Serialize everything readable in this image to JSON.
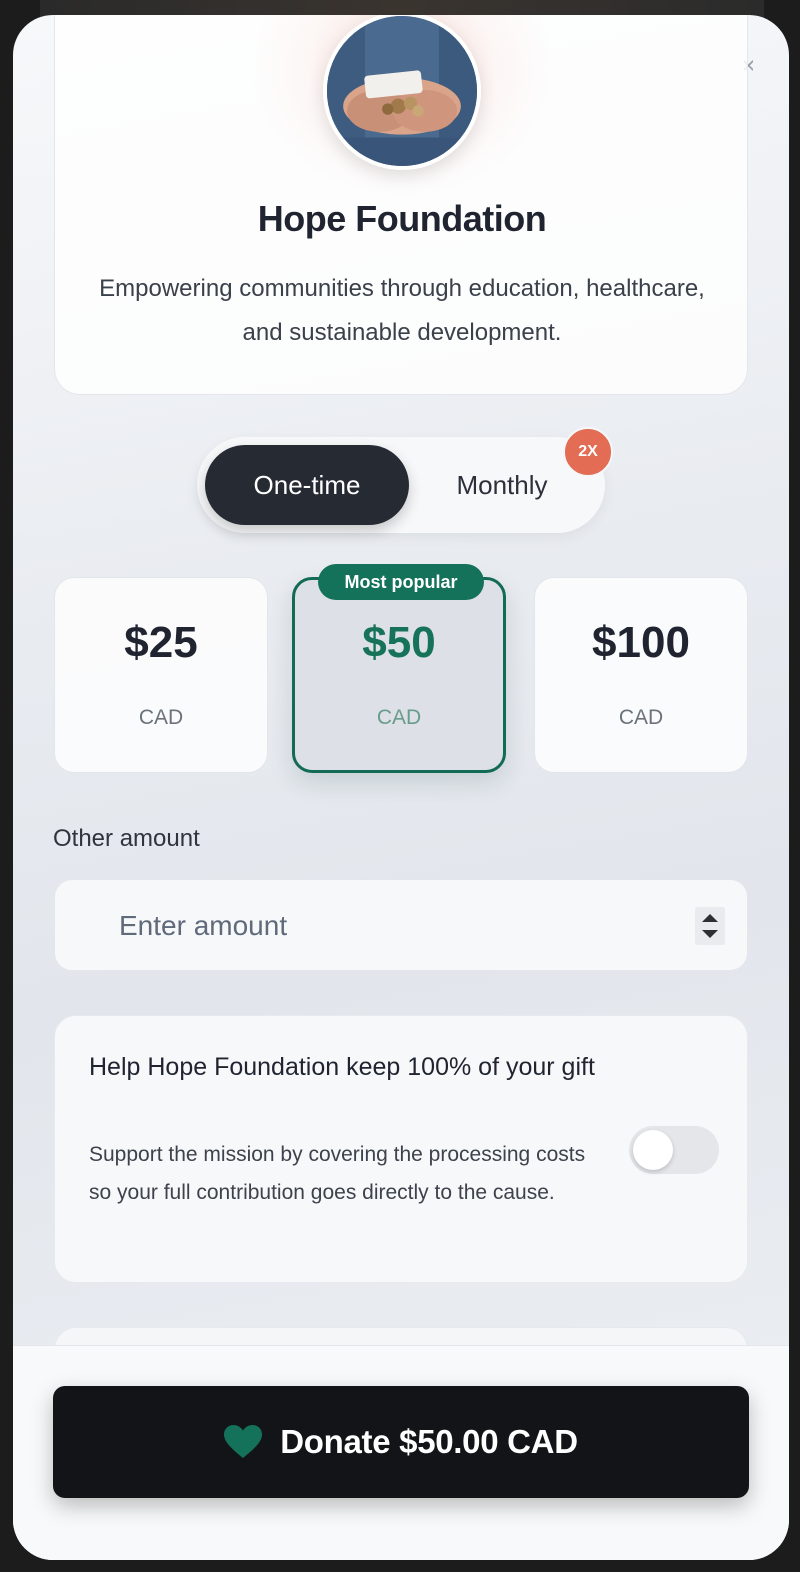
{
  "organization": {
    "name": "Hope Foundation",
    "description": "Empowering communities through education, healthcare, and sustainable development.",
    "avatar_icon": "hands-holding-coins-image"
  },
  "frequency": {
    "options": [
      {
        "label": "One-time",
        "selected": true
      },
      {
        "label": "Monthly",
        "selected": false
      }
    ],
    "badge": "2X"
  },
  "amounts": {
    "popular_label": "Most popular",
    "options": [
      {
        "value": "$25",
        "currency": "CAD",
        "selected": false
      },
      {
        "value": "$50",
        "currency": "CAD",
        "selected": true
      },
      {
        "value": "$100",
        "currency": "CAD",
        "selected": false
      }
    ]
  },
  "other_amount": {
    "label": "Other amount",
    "placeholder": "Enter amount",
    "value": ""
  },
  "fee_cover": {
    "title": "Help Hope Foundation keep 100% of your gift",
    "description": "Support the mission by covering the processing costs so your full contribution goes directly to the cause.",
    "enabled": false
  },
  "footer": {
    "donate_label": "Donate $50.00 CAD",
    "icon": "heart-icon"
  },
  "colors": {
    "accent": "#14715a",
    "badge": "#e26c54",
    "dark": "#131417"
  }
}
